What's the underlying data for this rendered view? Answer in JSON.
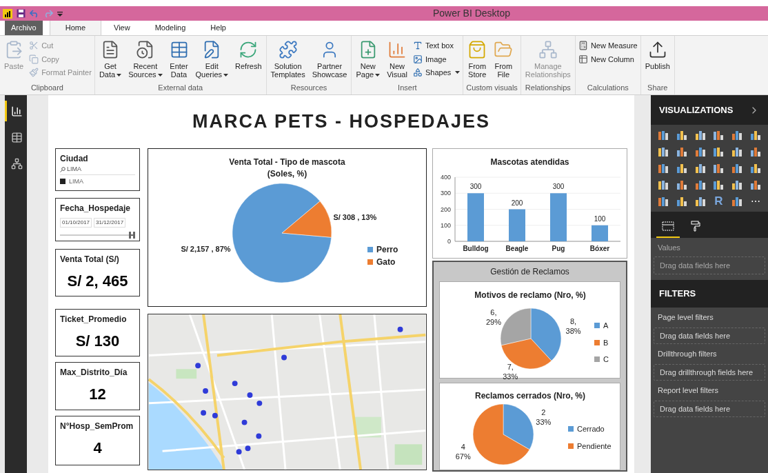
{
  "title_bar": {
    "title": "Power BI Desktop"
  },
  "ribbon_tabs": [
    {
      "label": "Archivo",
      "kind": "file",
      "selected": false
    },
    {
      "label": "Home",
      "kind": "tab",
      "selected": true
    },
    {
      "label": "View",
      "kind": "tab",
      "selected": false
    },
    {
      "label": "Modeling",
      "kind": "tab",
      "selected": false
    },
    {
      "label": "Help",
      "kind": "tab",
      "selected": false
    }
  ],
  "ribbon_groups": [
    {
      "label": "Clipboard",
      "items": [
        {
          "kind": "large",
          "lines": [
            "Paste"
          ],
          "dropdown": false,
          "disabled": true
        },
        {
          "kind": "stack",
          "items": [
            {
              "label": "Cut",
              "dropdown": false,
              "disabled": true
            },
            {
              "label": "Copy",
              "dropdown": false,
              "disabled": true
            },
            {
              "label": "Format Painter",
              "dropdown": false,
              "disabled": true
            }
          ]
        }
      ]
    },
    {
      "label": "External data",
      "items": [
        {
          "kind": "large",
          "lines": [
            "Get",
            "Data"
          ],
          "dropdown": true,
          "disabled": false
        },
        {
          "kind": "large",
          "lines": [
            "Recent",
            "Sources"
          ],
          "dropdown": true,
          "disabled": false
        },
        {
          "kind": "large",
          "lines": [
            "Enter",
            "Data"
          ],
          "dropdown": false,
          "disabled": false
        },
        {
          "kind": "large",
          "lines": [
            "Edit",
            "Queries"
          ],
          "dropdown": true,
          "disabled": false
        },
        {
          "kind": "large",
          "lines": [
            "Refresh"
          ],
          "dropdown": false,
          "disabled": false
        }
      ]
    },
    {
      "label": "Resources",
      "items": [
        {
          "kind": "large",
          "lines": [
            "Solution",
            "Templates"
          ],
          "dropdown": false,
          "disabled": false
        },
        {
          "kind": "large",
          "lines": [
            "Partner",
            "Showcase"
          ],
          "dropdown": false,
          "disabled": false
        }
      ]
    },
    {
      "label": "Insert",
      "items": [
        {
          "kind": "large",
          "lines": [
            "New",
            "Page"
          ],
          "dropdown": true,
          "disabled": false
        },
        {
          "kind": "large",
          "lines": [
            "New",
            "Visual"
          ],
          "dropdown": false,
          "disabled": false
        },
        {
          "kind": "stack",
          "items": [
            {
              "label": "Text box",
              "dropdown": false,
              "disabled": false
            },
            {
              "label": "Image",
              "dropdown": false,
              "disabled": false
            },
            {
              "label": "Shapes",
              "dropdown": true,
              "disabled": false
            }
          ]
        }
      ]
    },
    {
      "label": "Custom visuals",
      "items": [
        {
          "kind": "large",
          "lines": [
            "From",
            "Store"
          ],
          "dropdown": false,
          "disabled": false
        },
        {
          "kind": "large",
          "lines": [
            "From",
            "File"
          ],
          "dropdown": false,
          "disabled": false
        }
      ]
    },
    {
      "label": "Relationships",
      "items": [
        {
          "kind": "large",
          "lines": [
            "Manage",
            "Relationships"
          ],
          "dropdown": false,
          "disabled": true
        }
      ]
    },
    {
      "label": "Calculations",
      "items": [
        {
          "kind": "stack",
          "items": [
            {
              "label": "New Measure",
              "dropdown": false,
              "disabled": false
            },
            {
              "label": "New Column",
              "dropdown": false,
              "disabled": false
            }
          ]
        }
      ]
    },
    {
      "label": "Share",
      "items": [
        {
          "kind": "large",
          "lines": [
            "Publish"
          ],
          "dropdown": false,
          "disabled": false
        }
      ]
    }
  ],
  "views": [
    {
      "selected": true
    },
    {
      "selected": false
    },
    {
      "selected": false
    }
  ],
  "report": {
    "title": "MARCA PETS - HOSPEDAJES",
    "cards": [
      {
        "kind": "list_slicer",
        "title": "Ciudad",
        "search": "LIMA",
        "options": [
          {
            "label": "LIMA",
            "checked": true
          }
        ]
      },
      {
        "kind": "date_slicer",
        "title": "Fecha_Hospedaje",
        "start": "01/10/2017",
        "end": "31/12/2017",
        "level": 1
      },
      {
        "kind": "kpi",
        "title": "Venta Total (S/)",
        "value": "S/ 2, 465"
      },
      {
        "kind": "kpi",
        "title": "Ticket_Promedio",
        "value": "S/ 130"
      },
      {
        "kind": "kpi",
        "title": "Max_Distrito_Día",
        "value": "12"
      },
      {
        "kind": "kpi",
        "title": "N°Hosp_SemProm",
        "value": "4"
      }
    ],
    "pie": {
      "chart_data": {
        "type": "pie",
        "title": "Venta Total - Tipo de mascota\n(Soles, %)",
        "categories": [
          "Perro",
          "Gato"
        ],
        "values": [
          2157,
          308
        ],
        "colors": [
          "#5b9bd5",
          "#ed7d31"
        ],
        "value_labels": [
          "S/ 2,157 , 87%",
          "S/ 308 , 13%"
        ],
        "legend": "right"
      }
    },
    "bar": {
      "chart_data": {
        "type": "bar",
        "title": "Mascotas atendidas",
        "categories": [
          "Bulldog",
          "Beagle",
          "Pug",
          "Bóxer"
        ],
        "series": [
          {
            "color": "#5b9bd5",
            "values": [
              300,
              200,
              300,
              100
            ]
          }
        ],
        "ylim": [
          0,
          400
        ],
        "yticks": [
          0,
          100,
          200,
          300,
          400
        ],
        "data_labels": true,
        "grid": true
      }
    },
    "claims": {
      "title": "Gestión de Reclamos",
      "charts": [
        {
          "chart_data": {
            "type": "pie",
            "title": "Motivos de reclamo (Nro, %)",
            "categories": [
              "A",
              "B",
              "C"
            ],
            "values": [
              8,
              7,
              6
            ],
            "colors": [
              "#5b9bd5",
              "#ed7d31",
              "#a5a5a5"
            ],
            "value_labels": [
              "8, 38%",
              "7, 33%",
              "6, 29%"
            ],
            "legend": "right"
          }
        },
        {
          "chart_data": {
            "type": "pie",
            "title": "Reclamos cerrados (Nro, %)",
            "categories": [
              "Cerrado",
              "Pendiente"
            ],
            "values": [
              2,
              4
            ],
            "colors": [
              "#5b9bd5",
              "#ed7d31"
            ],
            "value_labels": [
              "2 33%",
              "4 67%"
            ],
            "legend": "right"
          }
        }
      ]
    }
  },
  "visualizations": {
    "title": "VISUALIZATIONS",
    "text_icons": [
      "R",
      "⋯"
    ],
    "pane_tabs": [
      {
        "selected": true
      },
      {
        "selected": false
      }
    ],
    "wells": [
      {
        "label": "Values",
        "hint": "Drag data fields here"
      }
    ]
  },
  "filters": {
    "title": "FILTERS",
    "sections": [
      {
        "label": "Page level filters",
        "hint": "Drag data fields here"
      },
      {
        "label": "Drillthrough filters",
        "hint": "Drag drillthrough fields here"
      },
      {
        "label": "Report level filters",
        "hint": "Drag data fields here"
      }
    ]
  }
}
